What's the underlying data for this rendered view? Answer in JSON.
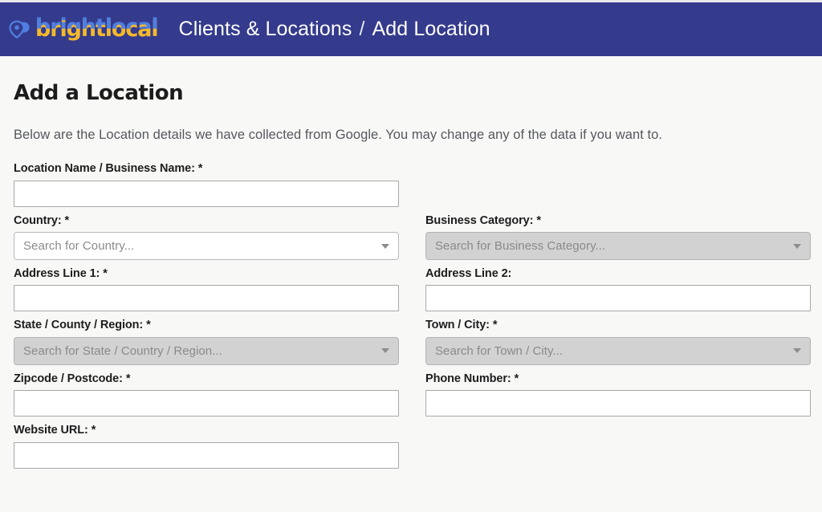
{
  "brand": {
    "logo_word_text": "brightlocal",
    "pin_icon": "map-pin-icon",
    "logo_blue": "#4f7fe0",
    "logo_yellow": "#f5b92a",
    "header_bg": "#343a8c"
  },
  "header": {
    "breadcrumb": {
      "parent": "Clients & Locations",
      "separator": "/",
      "current": "Add Location"
    }
  },
  "main": {
    "title": "Add a Location",
    "subtitle": "Below are the Location details we have collected from Google. You may change any of the data if you want to."
  },
  "form": {
    "fields": [
      {
        "name": "location-name",
        "label": "Location Name / Business Name:",
        "required": "*",
        "type": "text",
        "value": "",
        "placeholder": "",
        "disabled": false
      },
      {
        "name": "country",
        "label": "Country:",
        "required": "*",
        "type": "select",
        "value": "",
        "placeholder": "Search for Country...",
        "disabled": false
      },
      {
        "name": "business-category",
        "label": "Business Category:",
        "required": "*",
        "type": "select",
        "value": "",
        "placeholder": "Search for Business Category...",
        "disabled": true
      },
      {
        "name": "address-line-1",
        "label": "Address Line 1:",
        "required": "*",
        "type": "text",
        "value": "",
        "placeholder": "",
        "disabled": false
      },
      {
        "name": "address-line-2",
        "label": "Address Line 2:",
        "required": "",
        "type": "text",
        "value": "",
        "placeholder": "",
        "disabled": false
      },
      {
        "name": "state-county-region",
        "label": "State / County / Region:",
        "required": "*",
        "type": "select",
        "value": "",
        "placeholder": "Search for State / Country / Region...",
        "disabled": true
      },
      {
        "name": "town-city",
        "label": "Town / City:",
        "required": "*",
        "type": "select",
        "value": "",
        "placeholder": "Search for Town / City...",
        "disabled": true
      },
      {
        "name": "zipcode-postcode",
        "label": "Zipcode / Postcode:",
        "required": "*",
        "type": "text",
        "value": "",
        "placeholder": "",
        "disabled": false
      },
      {
        "name": "phone-number",
        "label": "Phone Number:",
        "required": "*",
        "type": "text",
        "value": "",
        "placeholder": "",
        "disabled": false
      },
      {
        "name": "website-url",
        "label": "Website URL:",
        "required": "*",
        "type": "text",
        "value": "",
        "placeholder": "",
        "disabled": false
      }
    ]
  }
}
